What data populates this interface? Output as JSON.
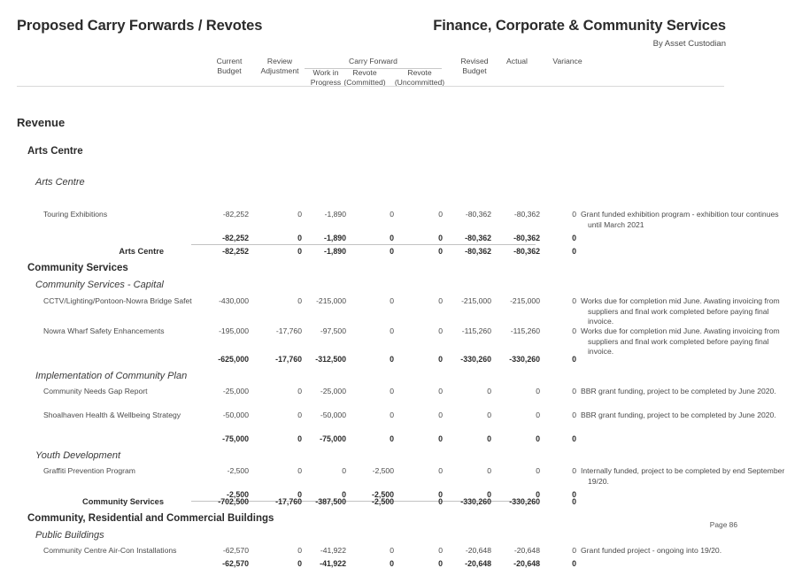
{
  "header": {
    "title_left": "Proposed Carry Forwards / Revotes",
    "title_right": "Finance, Corporate & Community Services",
    "subtitle_right": "By Asset Custodian"
  },
  "columns": {
    "current_budget_l1": "Current",
    "current_budget_l2": "Budget",
    "review_adjustment_l1": "Review",
    "review_adjustment_l2": "Adjustment",
    "carry_forward_group": "Carry Forward",
    "work_in_progress_l1": "Work in",
    "work_in_progress_l2": "Progress",
    "revote_committed_l1": "Revote",
    "revote_committed_l2": "(Committed)",
    "revote_uncommitted_l1": "Revote",
    "revote_uncommitted_l2": "(Uncommitted)",
    "revised_budget_l1": "Revised",
    "revised_budget_l2": "Budget",
    "actual": "Actual",
    "variance": "Variance"
  },
  "sections": {
    "revenue_heading": "Revenue",
    "arts_centre_group": "Arts Centre",
    "arts_centre_sub": "Arts Centre",
    "arts_centre_total_label": "Arts Centre",
    "community_services_group": "Community Services",
    "community_services_capital_sub": "Community Services - Capital",
    "implementation_sub": "Implementation of Community Plan",
    "youth_development_sub": "Youth Development",
    "community_services_total_label": "Community Services",
    "crc_buildings_group": "Community, Residential and Commercial Buildings",
    "public_buildings_sub": "Public Buildings"
  },
  "rows": {
    "touring_exhibitions": {
      "label": "Touring Exhibitions",
      "current_budget": "-82,252",
      "review_adjustment": "0",
      "work_in_progress": "-1,890",
      "revote_committed": "0",
      "revote_uncommitted": "0",
      "revised_budget": "-80,362",
      "actual": "-80,362",
      "variance": "0",
      "comment": "Grant funded exhibition program - exhibition tour continues until March 2021"
    },
    "arts_centre_subtotal": {
      "current_budget": "-82,252",
      "review_adjustment": "0",
      "work_in_progress": "-1,890",
      "revote_committed": "0",
      "revote_uncommitted": "0",
      "revised_budget": "-80,362",
      "actual": "-80,362",
      "variance": "0"
    },
    "arts_centre_total": {
      "current_budget": "-82,252",
      "review_adjustment": "0",
      "work_in_progress": "-1,890",
      "revote_committed": "0",
      "revote_uncommitted": "0",
      "revised_budget": "-80,362",
      "actual": "-80,362",
      "variance": "0"
    },
    "cctv_nowra_bridge": {
      "label": "CCTV/Lighting/Pontoon-Nowra Bridge Safet",
      "current_budget": "-430,000",
      "review_adjustment": "0",
      "work_in_progress": "-215,000",
      "revote_committed": "0",
      "revote_uncommitted": "0",
      "revised_budget": "-215,000",
      "actual": "-215,000",
      "variance": "0",
      "comment": "Works due for completion mid June. Awating invoicing from suppliers and final work completed before paying final invoice."
    },
    "nowra_wharf": {
      "label": "Nowra Wharf Safety Enhancements",
      "current_budget": "-195,000",
      "review_adjustment": "-17,760",
      "work_in_progress": "-97,500",
      "revote_committed": "0",
      "revote_uncommitted": "0",
      "revised_budget": "-115,260",
      "actual": "-115,260",
      "variance": "0",
      "comment": "Works due for completion mid June. Awating invoicing from suppliers and final work completed before paying final invoice."
    },
    "cs_capital_subtotal": {
      "current_budget": "-625,000",
      "review_adjustment": "-17,760",
      "work_in_progress": "-312,500",
      "revote_committed": "0",
      "revote_uncommitted": "0",
      "revised_budget": "-330,260",
      "actual": "-330,260",
      "variance": "0"
    },
    "community_needs_gap": {
      "label": "Community Needs Gap Report",
      "current_budget": "-25,000",
      "review_adjustment": "0",
      "work_in_progress": "-25,000",
      "revote_committed": "0",
      "revote_uncommitted": "0",
      "revised_budget": "0",
      "actual": "0",
      "variance": "0",
      "comment": "BBR grant funding, project to be completed by June 2020."
    },
    "shoalhaven_health": {
      "label": "Shoalhaven Health & Wellbeing Strategy",
      "current_budget": "-50,000",
      "review_adjustment": "0",
      "work_in_progress": "-50,000",
      "revote_committed": "0",
      "revote_uncommitted": "0",
      "revised_budget": "0",
      "actual": "0",
      "variance": "0",
      "comment": "BBR grant funding, project to be completed by June 2020."
    },
    "implementation_subtotal": {
      "current_budget": "-75,000",
      "review_adjustment": "0",
      "work_in_progress": "-75,000",
      "revote_committed": "0",
      "revote_uncommitted": "0",
      "revised_budget": "0",
      "actual": "0",
      "variance": "0"
    },
    "graffiti_prevention": {
      "label": "Graffiti Prevention Program",
      "current_budget": "-2,500",
      "review_adjustment": "0",
      "work_in_progress": "0",
      "revote_committed": "-2,500",
      "revote_uncommitted": "0",
      "revised_budget": "0",
      "actual": "0",
      "variance": "0",
      "comment": "Internally funded, project to be completed by end September 19/20."
    },
    "youth_subtotal": {
      "current_budget": "-2,500",
      "review_adjustment": "0",
      "work_in_progress": "0",
      "revote_committed": "-2,500",
      "revote_uncommitted": "0",
      "revised_budget": "0",
      "actual": "0",
      "variance": "0"
    },
    "community_services_total": {
      "current_budget": "-702,500",
      "review_adjustment": "-17,760",
      "work_in_progress": "-387,500",
      "revote_committed": "-2,500",
      "revote_uncommitted": "0",
      "revised_budget": "-330,260",
      "actual": "-330,260",
      "variance": "0"
    },
    "aircon_installations": {
      "label": "Community Centre Air-Con Installations",
      "current_budget": "-62,570",
      "review_adjustment": "0",
      "work_in_progress": "-41,922",
      "revote_committed": "0",
      "revote_uncommitted": "0",
      "revised_budget": "-20,648",
      "actual": "-20,648",
      "variance": "0",
      "comment": "Grant funded project - ongoing into 19/20."
    },
    "public_buildings_subtotal": {
      "current_budget": "-62,570",
      "review_adjustment": "0",
      "work_in_progress": "-41,922",
      "revote_committed": "0",
      "revote_uncommitted": "0",
      "revised_budget": "-20,648",
      "actual": "-20,648",
      "variance": "0"
    }
  },
  "footer": {
    "page_number": "Page 86"
  }
}
